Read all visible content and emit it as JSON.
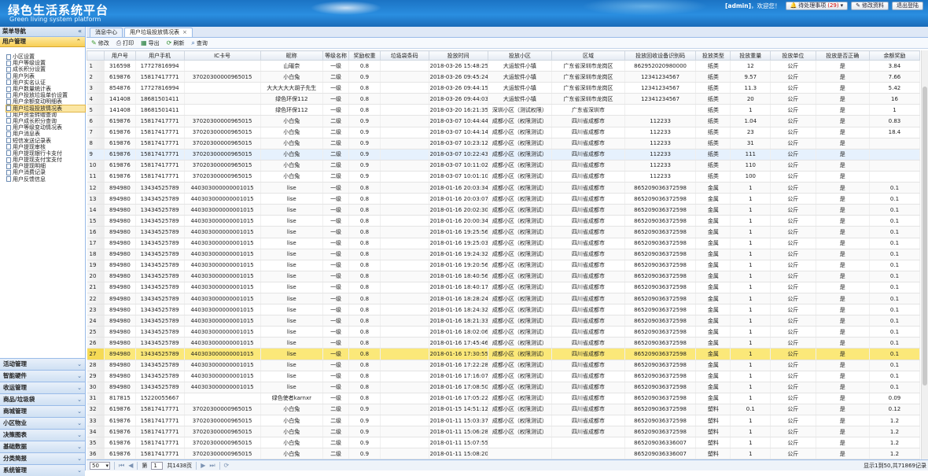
{
  "header": {
    "title": "绿色生活系统平台",
    "subtitle": "Green living system platform",
    "user": "[admin]",
    "welcome": "，欢迎您！",
    "todo": "待处理事项",
    "todo_count": "(29)",
    "edit_profile": "修改资料",
    "logout": "退出登陆"
  },
  "nav": {
    "title": "菜单导航",
    "active_group": "用户管理",
    "items": [
      "小区设置",
      "用户等级设置",
      "成长积分设置",
      "用户列表",
      "用户实名认证",
      "用户数量统计表",
      "用户投放垃圾单价设置",
      "用户余额变动明细表",
      "用户垃圾投放情况表",
      "用户资金转赠查询",
      "用户成长积分查询",
      "用户等级变动情况表",
      "用户消息表",
      "短信发送记录表",
      "用户提现审核",
      "用户提现银行卡支付",
      "用户提现支付宝支付",
      "用户提现明细",
      "用户消费记录",
      "用户反馈信息"
    ],
    "selected_item": "用户垃圾投放情况表",
    "groups": [
      "活动管理",
      "智能硬件",
      "收运管理",
      "商品/垃圾袋",
      "商城管理",
      "小区物业",
      "决策图表",
      "基础数据",
      "分类简报",
      "系统管理"
    ]
  },
  "tabs": [
    {
      "label": "消息中心"
    },
    {
      "label": "用户垃圾投放情况表"
    }
  ],
  "toolbar": {
    "edit": "修改",
    "print": "打印",
    "export": "导出",
    "refresh": "刷新",
    "query": "查询"
  },
  "table": {
    "headers": [
      "",
      "用户号",
      "用户手机",
      "IC卡号",
      "昵称",
      "等级名称",
      "奖励权重",
      "垃圾袋条码",
      "投放时间",
      "投放小区",
      "区域",
      "投放回收设备识别码",
      "投放类型",
      "投放重量",
      "投放单位",
      "投放是否正确",
      "余额奖励"
    ],
    "rows": [
      [
        "1",
        "316598",
        "17727816994",
        "",
        "山璀奈",
        "一级",
        "0.8",
        "",
        "2018-03-26 15:48:25",
        "大运软件小镇",
        "广东省深圳市龙岗区",
        "862952020980000",
        "纸类",
        "12",
        "公斤",
        "是",
        "3.84"
      ],
      [
        "2",
        "619876",
        "15817417771",
        "37020300000965015",
        "小白兔",
        "二级",
        "0.9",
        "",
        "2018-03-26 09:45:24",
        "大运软件小镇",
        "广东省深圳市龙岗区",
        "12341234567",
        "纸类",
        "9.57",
        "公斤",
        "是",
        "7.66"
      ],
      [
        "3",
        "854876",
        "17727816994",
        "",
        "大大大大大胡子先生",
        "一级",
        "0.8",
        "",
        "2018-03-26 09:44:15",
        "大运软件小镇",
        "广东省深圳市龙岗区",
        "12341234567",
        "纸类",
        "11.3",
        "公斤",
        "是",
        "5.42"
      ],
      [
        "4",
        "141408",
        "18681501411",
        "",
        "绿色环保112",
        "一级",
        "0.8",
        "",
        "2018-03-26 09:44:03",
        "大运软件小镇",
        "广东省深圳市龙岗区",
        "12341234567",
        "纸类",
        "20",
        "公斤",
        "是",
        "16"
      ],
      [
        "5",
        "141408",
        "18681501411",
        "",
        "绿色环保112",
        "一级",
        "0.8",
        "",
        "2018-03-20 16:21:35",
        "深圳小区（测试权限）",
        "广东省深圳市",
        "",
        "纸类",
        "1",
        "公斤",
        "是",
        "1"
      ],
      [
        "6",
        "619876",
        "15817417771",
        "37020300000965015",
        "小白兔",
        "二级",
        "0.9",
        "",
        "2018-03-07 10:44:44",
        "成都小区（权限测试）",
        "四川省成都市",
        "112233",
        "纸类",
        "1.04",
        "公斤",
        "是",
        "0.83"
      ],
      [
        "7",
        "619876",
        "15817417771",
        "37020300000965015",
        "小白兔",
        "二级",
        "0.9",
        "",
        "2018-03-07 10:44:14",
        "成都小区（权限测试）",
        "四川省成都市",
        "112233",
        "纸类",
        "23",
        "公斤",
        "是",
        "18.4"
      ],
      [
        "8",
        "619876",
        "15817417771",
        "37020300000965015",
        "小白兔",
        "二级",
        "0.9",
        "",
        "2018-03-07 10:23:12",
        "成都小区（权限测试）",
        "四川省成都市",
        "112233",
        "纸类",
        "31",
        "公斤",
        "是",
        ""
      ],
      [
        "9",
        "619876",
        "15817417771",
        "37020300000965015",
        "小白兔",
        "二级",
        "0.9",
        "",
        "2018-03-07 10:22:43",
        "成都小区（权限测试）",
        "四川省成都市",
        "112233",
        "纸类",
        "111",
        "公斤",
        "是",
        ""
      ],
      [
        "10",
        "619876",
        "15817417771",
        "37020300000965015",
        "小白兔",
        "二级",
        "0.9",
        "",
        "2018-03-07 10:11:02",
        "成都小区（权限测试）",
        "四川省成都市",
        "112233",
        "纸类",
        "110",
        "公斤",
        "是",
        ""
      ],
      [
        "11",
        "619876",
        "15817417771",
        "37020300000965015",
        "小白兔",
        "二级",
        "0.9",
        "",
        "2018-03-07 10:01:10",
        "成都小区（权限测试）",
        "四川省成都市",
        "112233",
        "纸类",
        "100",
        "公斤",
        "是",
        ""
      ],
      [
        "12",
        "894980",
        "13434525789",
        "440303000000001015",
        "lise",
        "一级",
        "0.8",
        "",
        "2018-01-16 20:03:34",
        "成都小区（权限测试）",
        "四川省成都市",
        "865209036372598",
        "金属",
        "1",
        "公斤",
        "是",
        "0.1"
      ],
      [
        "13",
        "894980",
        "13434525789",
        "440303000000001015",
        "lise",
        "一级",
        "0.8",
        "",
        "2018-01-16 20:03:07",
        "成都小区（权限测试）",
        "四川省成都市",
        "865209036372598",
        "金属",
        "1",
        "公斤",
        "是",
        "0.1"
      ],
      [
        "14",
        "894980",
        "13434525789",
        "440303000000001015",
        "lise",
        "一级",
        "0.8",
        "",
        "2018-01-16 20:02:30",
        "成都小区（权限测试）",
        "四川省成都市",
        "865209036372598",
        "金属",
        "1",
        "公斤",
        "是",
        "0.1"
      ],
      [
        "15",
        "894980",
        "13434525789",
        "440303000000001015",
        "lise",
        "一级",
        "0.8",
        "",
        "2018-01-16 20:00:34",
        "成都小区（权限测试）",
        "四川省成都市",
        "865209036372598",
        "金属",
        "1",
        "公斤",
        "是",
        "0.1"
      ],
      [
        "16",
        "894980",
        "13434525789",
        "440303000000001015",
        "lise",
        "一级",
        "0.8",
        "",
        "2018-01-16 19:25:56",
        "成都小区（权限测试）",
        "四川省成都市",
        "865209036372598",
        "金属",
        "1",
        "公斤",
        "是",
        "0.1"
      ],
      [
        "17",
        "894980",
        "13434525789",
        "440303000000001015",
        "lise",
        "一级",
        "0.8",
        "",
        "2018-01-16 19:25:03",
        "成都小区（权限测试）",
        "四川省成都市",
        "865209036372598",
        "金属",
        "1",
        "公斤",
        "是",
        "0.1"
      ],
      [
        "18",
        "894980",
        "13434525789",
        "440303000000001015",
        "lise",
        "一级",
        "0.8",
        "",
        "2018-01-16 19:24:32",
        "成都小区（权限测试）",
        "四川省成都市",
        "865209036372598",
        "金属",
        "1",
        "公斤",
        "是",
        "0.1"
      ],
      [
        "19",
        "894980",
        "13434525789",
        "440303000000001015",
        "lise",
        "一级",
        "0.8",
        "",
        "2018-01-16 19:20:56",
        "成都小区（权限测试）",
        "四川省成都市",
        "865209036372598",
        "金属",
        "1",
        "公斤",
        "是",
        "0.1"
      ],
      [
        "20",
        "894980",
        "13434525789",
        "440303000000001015",
        "lise",
        "一级",
        "0.8",
        "",
        "2018-01-16 18:40:56",
        "成都小区（权限测试）",
        "四川省成都市",
        "865209036372598",
        "金属",
        "1",
        "公斤",
        "是",
        "0.1"
      ],
      [
        "21",
        "894980",
        "13434525789",
        "440303000000001015",
        "lise",
        "一级",
        "0.8",
        "",
        "2018-01-16 18:40:17",
        "成都小区（权限测试）",
        "四川省成都市",
        "865209036372598",
        "金属",
        "1",
        "公斤",
        "是",
        "0.1"
      ],
      [
        "22",
        "894980",
        "13434525789",
        "440303000000001015",
        "lise",
        "一级",
        "0.8",
        "",
        "2018-01-16 18:28:24",
        "成都小区（权限测试）",
        "四川省成都市",
        "865209036372598",
        "金属",
        "1",
        "公斤",
        "是",
        "0.1"
      ],
      [
        "23",
        "894980",
        "13434525789",
        "440303000000001015",
        "lise",
        "一级",
        "0.8",
        "",
        "2018-01-16 18:24:32",
        "成都小区（权限测试）",
        "四川省成都市",
        "865209036372598",
        "金属",
        "1",
        "公斤",
        "是",
        "0.1"
      ],
      [
        "24",
        "894980",
        "13434525789",
        "440303000000001015",
        "lise",
        "一级",
        "0.8",
        "",
        "2018-01-16 18:21:33",
        "成都小区（权限测试）",
        "四川省成都市",
        "865209036372598",
        "金属",
        "1",
        "公斤",
        "是",
        "0.1"
      ],
      [
        "25",
        "894980",
        "13434525789",
        "440303000000001015",
        "lise",
        "一级",
        "0.8",
        "",
        "2018-01-16 18:02:06",
        "成都小区（权限测试）",
        "四川省成都市",
        "865209036372598",
        "金属",
        "1",
        "公斤",
        "是",
        "0.1"
      ],
      [
        "26",
        "894980",
        "13434525789",
        "440303000000001015",
        "lise",
        "一级",
        "0.8",
        "",
        "2018-01-16 17:45:46",
        "成都小区（权限测试）",
        "四川省成都市",
        "865209036372598",
        "金属",
        "1",
        "公斤",
        "是",
        "0.1"
      ],
      [
        "27",
        "894980",
        "13434525789",
        "440303000000001015",
        "lise",
        "一级",
        "0.8",
        "",
        "2018-01-16 17:30:55",
        "成都小区（权限测试）",
        "四川省成都市",
        "865209036372598",
        "金属",
        "1",
        "公斤",
        "是",
        "0.1"
      ],
      [
        "28",
        "894980",
        "13434525789",
        "440303000000001015",
        "lise",
        "一级",
        "0.8",
        "",
        "2018-01-16 17:22:28",
        "成都小区（权限测试）",
        "四川省成都市",
        "865209036372598",
        "金属",
        "1",
        "公斤",
        "是",
        "0.1"
      ],
      [
        "29",
        "894980",
        "13434525789",
        "440303000000001015",
        "lise",
        "一级",
        "0.8",
        "",
        "2018-01-16 17:16:07",
        "成都小区（权限测试）",
        "四川省成都市",
        "865209036372598",
        "金属",
        "1",
        "公斤",
        "是",
        "0.1"
      ],
      [
        "30",
        "894980",
        "13434525789",
        "440303000000001015",
        "lise",
        "一级",
        "0.8",
        "",
        "2018-01-16 17:08:50",
        "成都小区（权限测试）",
        "四川省成都市",
        "865209036372598",
        "金属",
        "1",
        "公斤",
        "是",
        "0.1"
      ],
      [
        "31",
        "817815",
        "15220055667",
        "",
        "绿色使者karnxr",
        "一级",
        "0.8",
        "",
        "2018-01-16 17:05:22",
        "成都小区（权限测试）",
        "四川省成都市",
        "865209036372598",
        "金属",
        "1",
        "公斤",
        "是",
        "0.09"
      ],
      [
        "32",
        "619876",
        "15817417771",
        "37020300000965015",
        "小白兔",
        "二级",
        "0.9",
        "",
        "2018-01-15 14:51:12",
        "成都小区（权限测试）",
        "四川省成都市",
        "865209036372598",
        "塑料",
        "0.1",
        "公斤",
        "是",
        "0.12"
      ],
      [
        "33",
        "619876",
        "15817417771",
        "37020300000965015",
        "小白兔",
        "二级",
        "0.9",
        "",
        "2018-01-11 15:03:37",
        "成都小区（权限测试）",
        "四川省成都市",
        "865209036372598",
        "塑料",
        "1",
        "公斤",
        "是",
        "1.2"
      ],
      [
        "34",
        "619876",
        "15817417771",
        "37020300000965015",
        "小白兔",
        "二级",
        "0.9",
        "",
        "2018-01-11 15:06:28",
        "成都小区（权限测试）",
        "四川省成都市",
        "865209036372598",
        "塑料",
        "1",
        "公斤",
        "是",
        "1.2"
      ],
      [
        "35",
        "619876",
        "15817417771",
        "37020300000965015",
        "小白兔",
        "二级",
        "0.9",
        "",
        "2018-01-11 15:07:55",
        "",
        "",
        "865209036336007",
        "塑料",
        "1",
        "公斤",
        "是",
        "1.2"
      ],
      [
        "36",
        "619876",
        "15817417771",
        "37020300000965015",
        "小白兔",
        "二级",
        "0.9",
        "",
        "2018-01-11 15:08:20",
        "",
        "",
        "865209036336007",
        "塑料",
        "1",
        "公斤",
        "是",
        "1.2"
      ]
    ]
  },
  "pager": {
    "page_size": "50",
    "page_prefix": "第",
    "page_input": "1",
    "page_total": "共1438页",
    "info": "显示1到50,共71869记录"
  }
}
